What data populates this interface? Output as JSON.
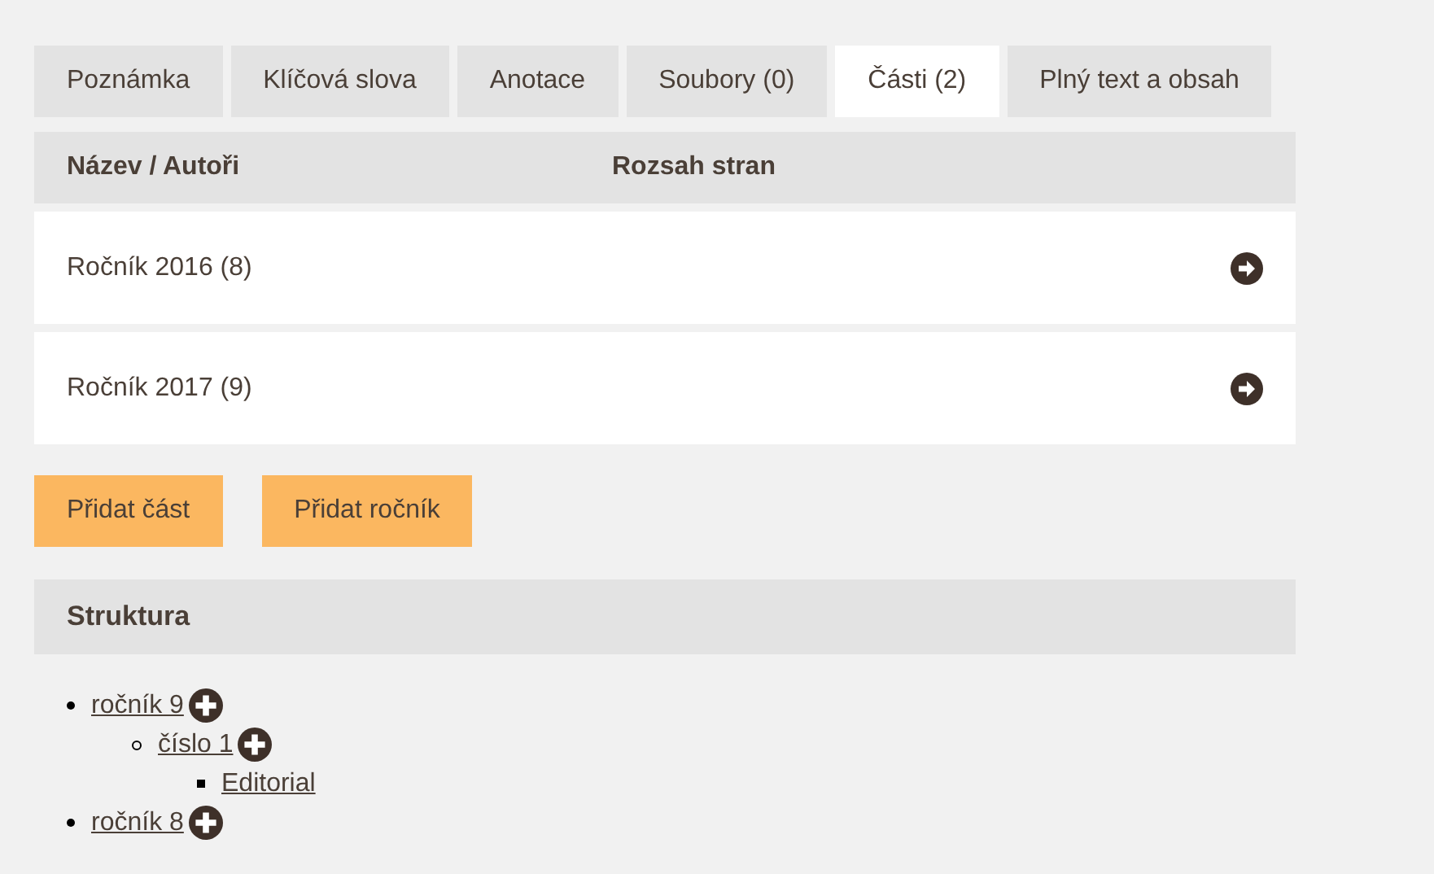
{
  "tabs": [
    {
      "label": "Poznámka",
      "selected": false
    },
    {
      "label": "Klíčová slova",
      "selected": false
    },
    {
      "label": "Anotace",
      "selected": false
    },
    {
      "label": "Soubory (0)",
      "selected": false
    },
    {
      "label": "Části (2)",
      "selected": true
    },
    {
      "label": "Plný text a obsah",
      "selected": false
    }
  ],
  "table": {
    "columns": [
      "Název / Autoři",
      "Rozsah stran"
    ],
    "rows": [
      {
        "name": "Ročník 2016 (8)"
      },
      {
        "name": "Ročník 2017 (9)"
      }
    ]
  },
  "buttons": [
    "Přidat část",
    "Přidat ročník"
  ],
  "structure": {
    "title": "Struktura",
    "items": [
      {
        "label": "ročník 9",
        "addable": true,
        "children": [
          {
            "label": "číslo 1",
            "addable": true,
            "children": [
              {
                "label": "Editorial",
                "addable": false
              }
            ]
          }
        ]
      },
      {
        "label": "ročník 8",
        "addable": true
      }
    ]
  }
}
